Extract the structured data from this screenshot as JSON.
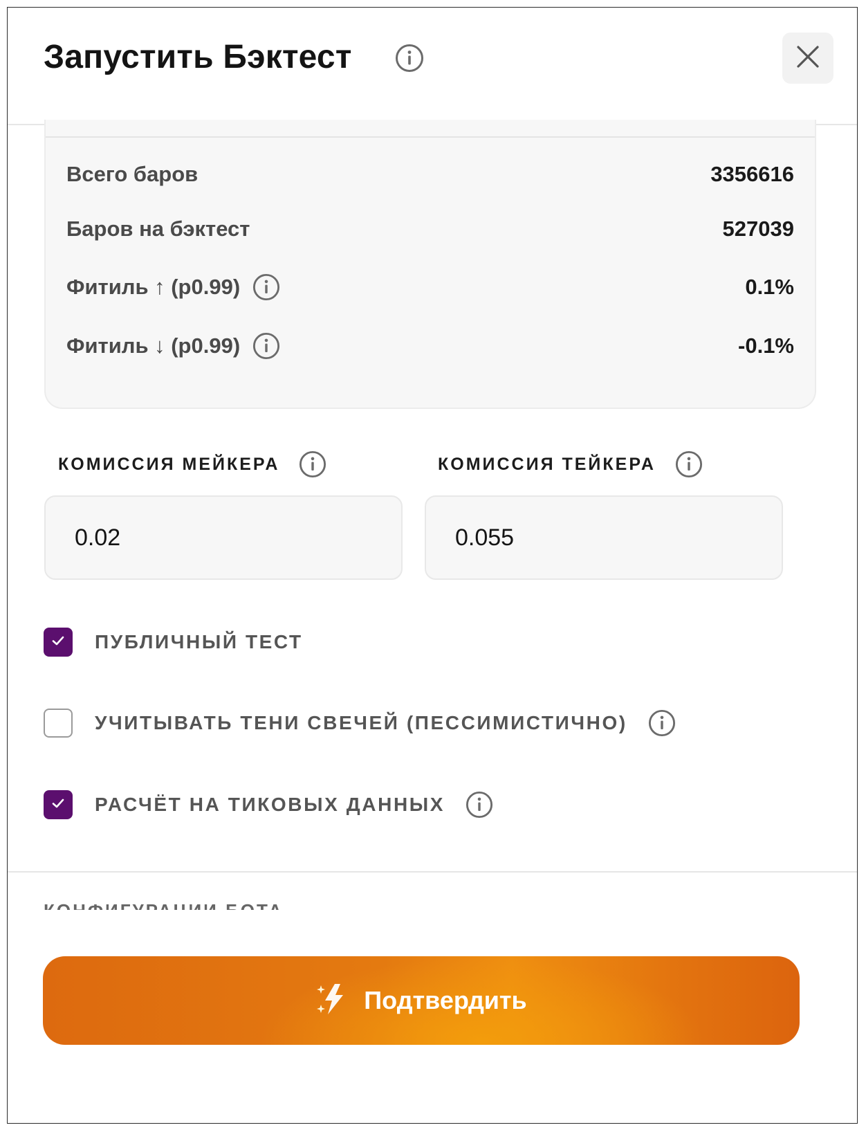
{
  "header": {
    "title": "Запустить Бэктест",
    "close_symbol": "×"
  },
  "stats": [
    {
      "label": "Всего баров",
      "value": "3356616",
      "info": false
    },
    {
      "label": "Баров на бэктест",
      "value": "527039",
      "info": false
    },
    {
      "label": "Фитиль ↑ (p0.99)",
      "value": "0.1%",
      "info": true
    },
    {
      "label": "Фитиль ↓ (p0.99)",
      "value": "-0.1%",
      "info": true
    }
  ],
  "fees": {
    "maker_label": "КОМИССИЯ МЕЙКЕРА",
    "maker_value": "0.02",
    "taker_label": "КОМИССИЯ ТЕЙКЕРА",
    "taker_value": "0.055"
  },
  "options": [
    {
      "label": "ПУБЛИЧНЫЙ ТЕСТ",
      "checked": true
    },
    {
      "label": "УЧИТЫВАТЬ ТЕНИ СВЕЧЕЙ (ПЕССИМИСТИЧНО)",
      "checked": false
    },
    {
      "label": "РАСЧЁТ НА ТИКОВЫХ ДАННЫХ",
      "checked": true
    }
  ],
  "section_cut_label": "КОНФИГУРАЦИИ БОТА",
  "confirm_label": "Подтвердить",
  "colors": {
    "checkbox_checked": "#5b0f6e",
    "button_orange": "#e47a10",
    "button_highlight": "#f39c0c"
  },
  "icons": {
    "info": "info-icon",
    "close": "close-icon",
    "sparkle": "sparkle-bolt-icon",
    "check": "check-icon"
  }
}
